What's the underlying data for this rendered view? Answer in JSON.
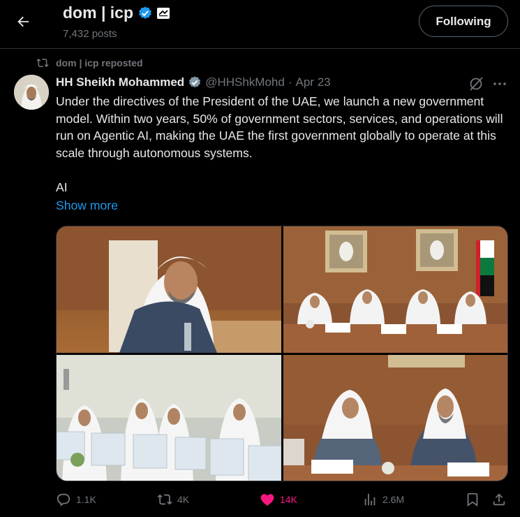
{
  "header": {
    "back_icon": "arrow-left-icon",
    "name": "dom | icp",
    "posts": "7,432 posts",
    "follow_label": "Following"
  },
  "repost": {
    "label": "dom | icp reposted"
  },
  "tweet": {
    "author_name": "HH Sheikh Mohammed",
    "handle": "@HHShkMohd",
    "separator": "·",
    "date": "Apr 23",
    "text": "Under the directives of the President of the UAE, we launch a new government model. Within two years, 50% of government sectors, services, and operations will run on Agentic AI, making the UAE the first government globally to operate at this scale through autonomous systems.",
    "text_tail": "AI",
    "show_more": "Show more"
  },
  "actions": {
    "replies": "1.1K",
    "reposts": "4K",
    "likes": "14K",
    "views": "2.6M"
  },
  "colors": {
    "accent": "#1d9bf0",
    "like": "#f91880",
    "muted": "#71767b",
    "border": "#2f3336"
  }
}
